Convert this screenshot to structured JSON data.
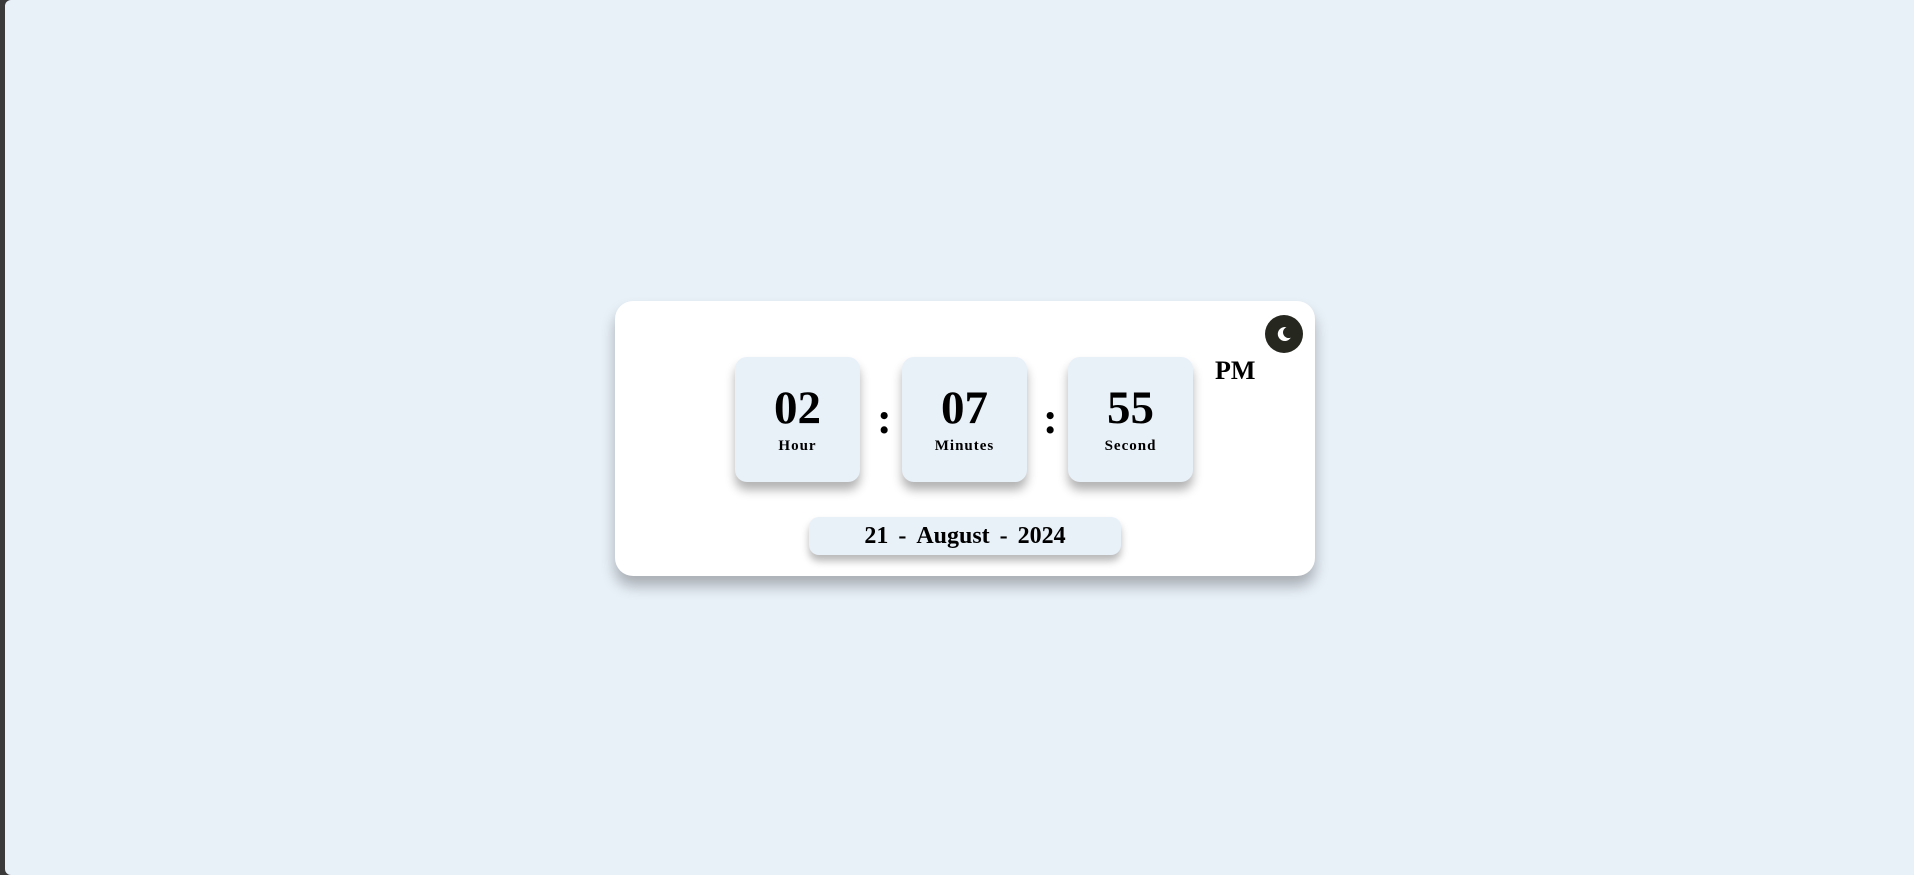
{
  "clock": {
    "hour": "02",
    "hour_label": "Hour",
    "minutes": "07",
    "minutes_label": "Minutes",
    "seconds": "55",
    "seconds_label": "Second",
    "separator": ":",
    "ampm": "PM"
  },
  "date": {
    "day": "21",
    "month": "August",
    "year": "2024",
    "separator": "-"
  },
  "theme_toggle": {
    "icon": "moon-icon",
    "background": "#26271f"
  },
  "colors": {
    "page_background": "#e8f0f8",
    "card_background": "#ffffff",
    "tile_background": "#e8f0f8"
  }
}
